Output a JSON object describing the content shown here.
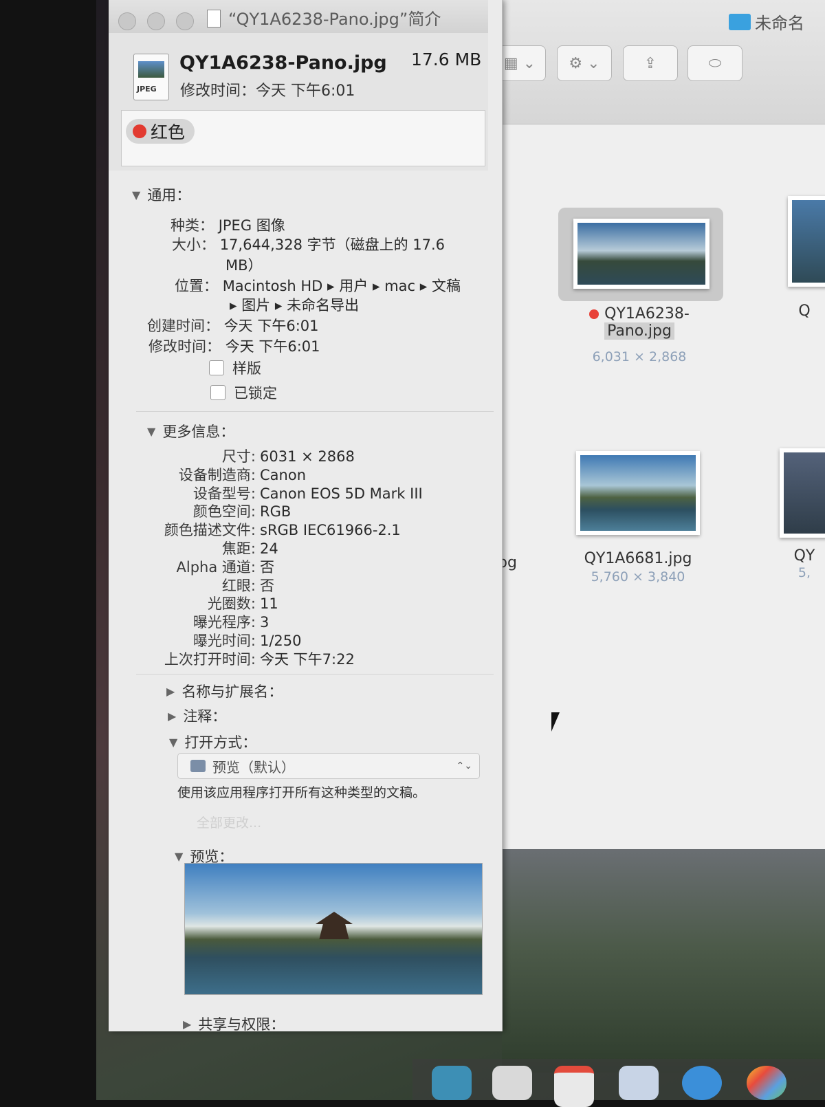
{
  "panel": {
    "title": "“QY1A6238-Pano.jpg”简介",
    "icon_label": "JPEG",
    "file_name": "QY1A6238-Pano.jpg",
    "file_size": "17.6 MB",
    "modified_summary": "修改时间：今天 下午6:01",
    "tag": {
      "name": "红色",
      "color": "#e23a30"
    }
  },
  "general": {
    "heading": "通用：",
    "kind_key": "种类：",
    "kind_val": "JPEG 图像",
    "size_key": "大小：",
    "size_val_line1": "17,644,328 字节（磁盘上的 17.6",
    "size_val_line2": "MB）",
    "where_key": "位置：",
    "where_path_line1": [
      "Macintosh HD",
      "用户",
      "mac",
      "文稿"
    ],
    "where_path_line2": [
      "图片",
      "未命名导出"
    ],
    "created_key": "创建时间：",
    "created_val": "今天 下午6:01",
    "modified_key": "修改时间：",
    "modified_val": "今天 下午6:01",
    "stationery_label": "样版",
    "locked_label": "已锁定"
  },
  "more_info": {
    "heading": "更多信息：",
    "rows": [
      {
        "k": "尺寸:",
        "v": "6031 × 2868"
      },
      {
        "k": "设备制造商:",
        "v": "Canon"
      },
      {
        "k": "设备型号:",
        "v": "Canon EOS 5D Mark III"
      },
      {
        "k": "颜色空间:",
        "v": "RGB"
      },
      {
        "k": "颜色描述文件:",
        "v": "sRGB IEC61966-2.1"
      },
      {
        "k": "焦距:",
        "v": "24"
      },
      {
        "k": "Alpha 通道:",
        "v": "否"
      },
      {
        "k": "红眼:",
        "v": "否"
      },
      {
        "k": "光圈数:",
        "v": "11"
      },
      {
        "k": "曝光程序:",
        "v": "3"
      },
      {
        "k": "曝光时间:",
        "v": "1/250"
      },
      {
        "k": "上次打开时间:",
        "v": "今天 下午7:22"
      }
    ]
  },
  "sections": {
    "name_ext": "名称与扩展名：",
    "comments": "注释：",
    "open_with": "打开方式：",
    "open_with_app": "预览（默认）",
    "open_with_help": "使用该应用程序打开所有这种类型的文稿。",
    "change_all": "全部更改...",
    "preview": "预览：",
    "sharing": "共享与权限："
  },
  "finder": {
    "folder_title": "未命名",
    "files": [
      {
        "name_line1": "QY1A6238-",
        "name_line2": "Pano.jpg",
        "dims": "6,031 × 2,868",
        "tag_color": "#e84138"
      },
      {
        "name_line1": "QY1A6681.jpg",
        "dims": "5,760 × 3,840"
      },
      {
        "partial": "Q"
      },
      {
        "partial": "QY",
        "partial_dims": "5,"
      }
    ],
    "left_partial": "pg"
  }
}
